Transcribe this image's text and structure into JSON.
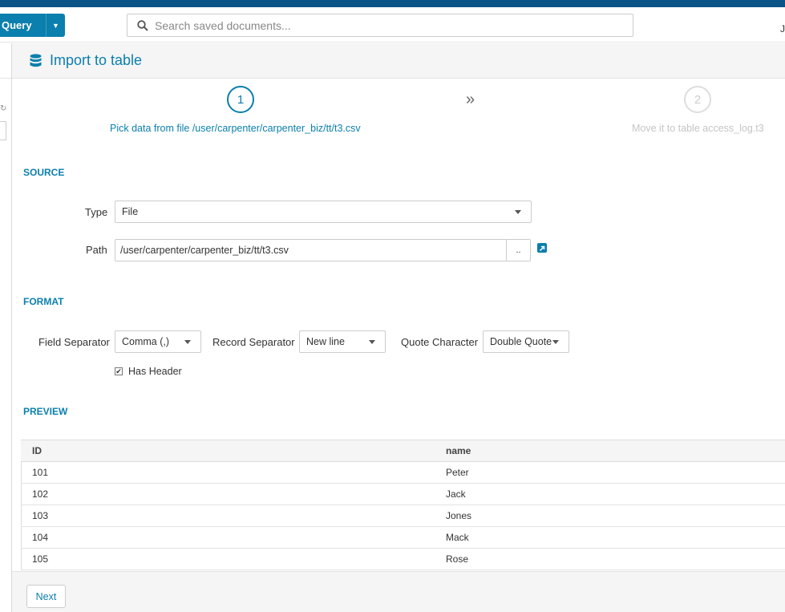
{
  "topbar": {
    "query_label": "Query",
    "search_placeholder": "Search saved documents...",
    "right_glyph": "J"
  },
  "header": {
    "title": "Import to table"
  },
  "steps": [
    {
      "number": "1",
      "label": "Pick data from file /user/carpenter/carpenter_biz/tt/t3.csv",
      "active": true
    },
    {
      "number": "2",
      "label": "Move it to table access_log.t3",
      "active": false
    }
  ],
  "step_separator": "»",
  "source": {
    "section_title": "SOURCE",
    "type_label": "Type",
    "type_value": "File",
    "path_label": "Path",
    "path_value": "/user/carpenter/carpenter_biz/tt/t3.csv",
    "browse_label": ".."
  },
  "format": {
    "section_title": "FORMAT",
    "field_separator_label": "Field Separator",
    "field_separator_value": "Comma (,)",
    "record_separator_label": "Record Separator",
    "record_separator_value": "New line",
    "quote_character_label": "Quote Character",
    "quote_character_value": "Double Quote",
    "has_header_label": "Has Header",
    "has_header_checked": true
  },
  "preview": {
    "section_title": "PREVIEW",
    "columns": [
      "ID",
      "name"
    ],
    "rows": [
      [
        "101",
        "Peter"
      ],
      [
        "102",
        "Jack"
      ],
      [
        "103",
        "Jones"
      ],
      [
        "104",
        "Mack"
      ],
      [
        "105",
        "Rose"
      ]
    ]
  },
  "footer": {
    "next_label": "Next"
  },
  "colors": {
    "accent": "#0b7fad",
    "topstrip": "#0b5488"
  }
}
